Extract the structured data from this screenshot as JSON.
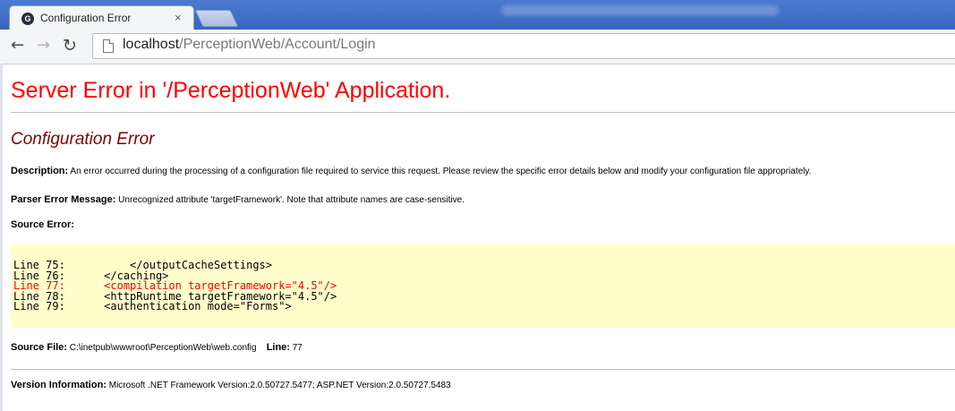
{
  "browser": {
    "tab_title": "Configuration Error",
    "tab_close": "×",
    "url_host": "localhost",
    "url_path": "/PerceptionWeb/Account/Login",
    "icons": [
      "ge-favicon-icon",
      "back-arrow-icon",
      "forward-arrow-icon",
      "reload-icon",
      "page-icon"
    ]
  },
  "page": {
    "server_error_title": "Server Error in '/PerceptionWeb' Application.",
    "error_heading": "Configuration Error",
    "description_label": "Description:",
    "description_text": " An error occurred during the processing of a configuration file required to service this request. Please review the specific error details below and modify your configuration file appropriately.",
    "parser_label": "Parser Error Message:",
    "parser_text": " Unrecognized attribute 'targetFramework'. Note that attribute names are case-sensitive.",
    "source_error_label": "Source Error:",
    "source_lines": [
      {
        "line": "Line 75:",
        "code": "        </outputCacheSettings>"
      },
      {
        "line": "Line 76:",
        "code": "    </caching>"
      },
      {
        "line": "Line 77:",
        "code": "    <compilation targetFramework=\"4.5\"/>"
      },
      {
        "line": "Line 78:",
        "code": "    <httpRuntime targetFramework=\"4.5\"/>"
      },
      {
        "line": "Line 79:",
        "code": "    <authentication mode=\"Forms\">"
      }
    ],
    "source_file_label": "Source File:",
    "source_file_path": " C:\\inetpub\\wwwroot\\PerceptionWeb\\web.config",
    "line_label": "Line:",
    "line_number": " 77",
    "version_label": "Version Information:",
    "version_text": " Microsoft .NET Framework Version:2.0.50727.5477; ASP.NET Version:2.0.50727.5483"
  },
  "colors": {
    "title_red": "#ff0000",
    "heading_maroon": "#800000",
    "code_background": "#ffffcc",
    "highlighted_line": "#ff0000"
  }
}
